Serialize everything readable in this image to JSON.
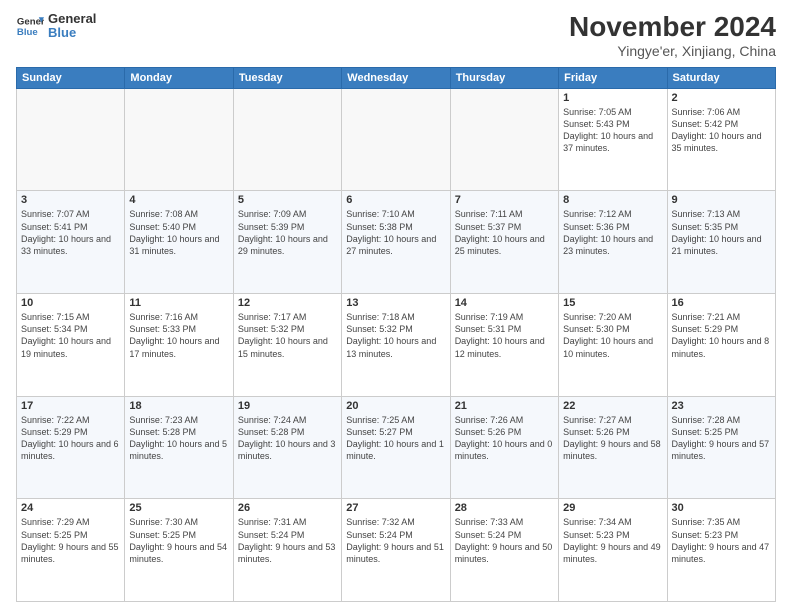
{
  "logo": {
    "line1": "General",
    "line2": "Blue"
  },
  "title": "November 2024",
  "subtitle": "Yingye'er, Xinjiang, China",
  "days_of_week": [
    "Sunday",
    "Monday",
    "Tuesday",
    "Wednesday",
    "Thursday",
    "Friday",
    "Saturday"
  ],
  "weeks": [
    [
      {
        "day": "",
        "info": ""
      },
      {
        "day": "",
        "info": ""
      },
      {
        "day": "",
        "info": ""
      },
      {
        "day": "",
        "info": ""
      },
      {
        "day": "",
        "info": ""
      },
      {
        "day": "1",
        "info": "Sunrise: 7:05 AM\nSunset: 5:43 PM\nDaylight: 10 hours and 37 minutes."
      },
      {
        "day": "2",
        "info": "Sunrise: 7:06 AM\nSunset: 5:42 PM\nDaylight: 10 hours and 35 minutes."
      }
    ],
    [
      {
        "day": "3",
        "info": "Sunrise: 7:07 AM\nSunset: 5:41 PM\nDaylight: 10 hours and 33 minutes."
      },
      {
        "day": "4",
        "info": "Sunrise: 7:08 AM\nSunset: 5:40 PM\nDaylight: 10 hours and 31 minutes."
      },
      {
        "day": "5",
        "info": "Sunrise: 7:09 AM\nSunset: 5:39 PM\nDaylight: 10 hours and 29 minutes."
      },
      {
        "day": "6",
        "info": "Sunrise: 7:10 AM\nSunset: 5:38 PM\nDaylight: 10 hours and 27 minutes."
      },
      {
        "day": "7",
        "info": "Sunrise: 7:11 AM\nSunset: 5:37 PM\nDaylight: 10 hours and 25 minutes."
      },
      {
        "day": "8",
        "info": "Sunrise: 7:12 AM\nSunset: 5:36 PM\nDaylight: 10 hours and 23 minutes."
      },
      {
        "day": "9",
        "info": "Sunrise: 7:13 AM\nSunset: 5:35 PM\nDaylight: 10 hours and 21 minutes."
      }
    ],
    [
      {
        "day": "10",
        "info": "Sunrise: 7:15 AM\nSunset: 5:34 PM\nDaylight: 10 hours and 19 minutes."
      },
      {
        "day": "11",
        "info": "Sunrise: 7:16 AM\nSunset: 5:33 PM\nDaylight: 10 hours and 17 minutes."
      },
      {
        "day": "12",
        "info": "Sunrise: 7:17 AM\nSunset: 5:32 PM\nDaylight: 10 hours and 15 minutes."
      },
      {
        "day": "13",
        "info": "Sunrise: 7:18 AM\nSunset: 5:32 PM\nDaylight: 10 hours and 13 minutes."
      },
      {
        "day": "14",
        "info": "Sunrise: 7:19 AM\nSunset: 5:31 PM\nDaylight: 10 hours and 12 minutes."
      },
      {
        "day": "15",
        "info": "Sunrise: 7:20 AM\nSunset: 5:30 PM\nDaylight: 10 hours and 10 minutes."
      },
      {
        "day": "16",
        "info": "Sunrise: 7:21 AM\nSunset: 5:29 PM\nDaylight: 10 hours and 8 minutes."
      }
    ],
    [
      {
        "day": "17",
        "info": "Sunrise: 7:22 AM\nSunset: 5:29 PM\nDaylight: 10 hours and 6 minutes."
      },
      {
        "day": "18",
        "info": "Sunrise: 7:23 AM\nSunset: 5:28 PM\nDaylight: 10 hours and 5 minutes."
      },
      {
        "day": "19",
        "info": "Sunrise: 7:24 AM\nSunset: 5:28 PM\nDaylight: 10 hours and 3 minutes."
      },
      {
        "day": "20",
        "info": "Sunrise: 7:25 AM\nSunset: 5:27 PM\nDaylight: 10 hours and 1 minute."
      },
      {
        "day": "21",
        "info": "Sunrise: 7:26 AM\nSunset: 5:26 PM\nDaylight: 10 hours and 0 minutes."
      },
      {
        "day": "22",
        "info": "Sunrise: 7:27 AM\nSunset: 5:26 PM\nDaylight: 9 hours and 58 minutes."
      },
      {
        "day": "23",
        "info": "Sunrise: 7:28 AM\nSunset: 5:25 PM\nDaylight: 9 hours and 57 minutes."
      }
    ],
    [
      {
        "day": "24",
        "info": "Sunrise: 7:29 AM\nSunset: 5:25 PM\nDaylight: 9 hours and 55 minutes."
      },
      {
        "day": "25",
        "info": "Sunrise: 7:30 AM\nSunset: 5:25 PM\nDaylight: 9 hours and 54 minutes."
      },
      {
        "day": "26",
        "info": "Sunrise: 7:31 AM\nSunset: 5:24 PM\nDaylight: 9 hours and 53 minutes."
      },
      {
        "day": "27",
        "info": "Sunrise: 7:32 AM\nSunset: 5:24 PM\nDaylight: 9 hours and 51 minutes."
      },
      {
        "day": "28",
        "info": "Sunrise: 7:33 AM\nSunset: 5:24 PM\nDaylight: 9 hours and 50 minutes."
      },
      {
        "day": "29",
        "info": "Sunrise: 7:34 AM\nSunset: 5:23 PM\nDaylight: 9 hours and 49 minutes."
      },
      {
        "day": "30",
        "info": "Sunrise: 7:35 AM\nSunset: 5:23 PM\nDaylight: 9 hours and 47 minutes."
      }
    ]
  ]
}
